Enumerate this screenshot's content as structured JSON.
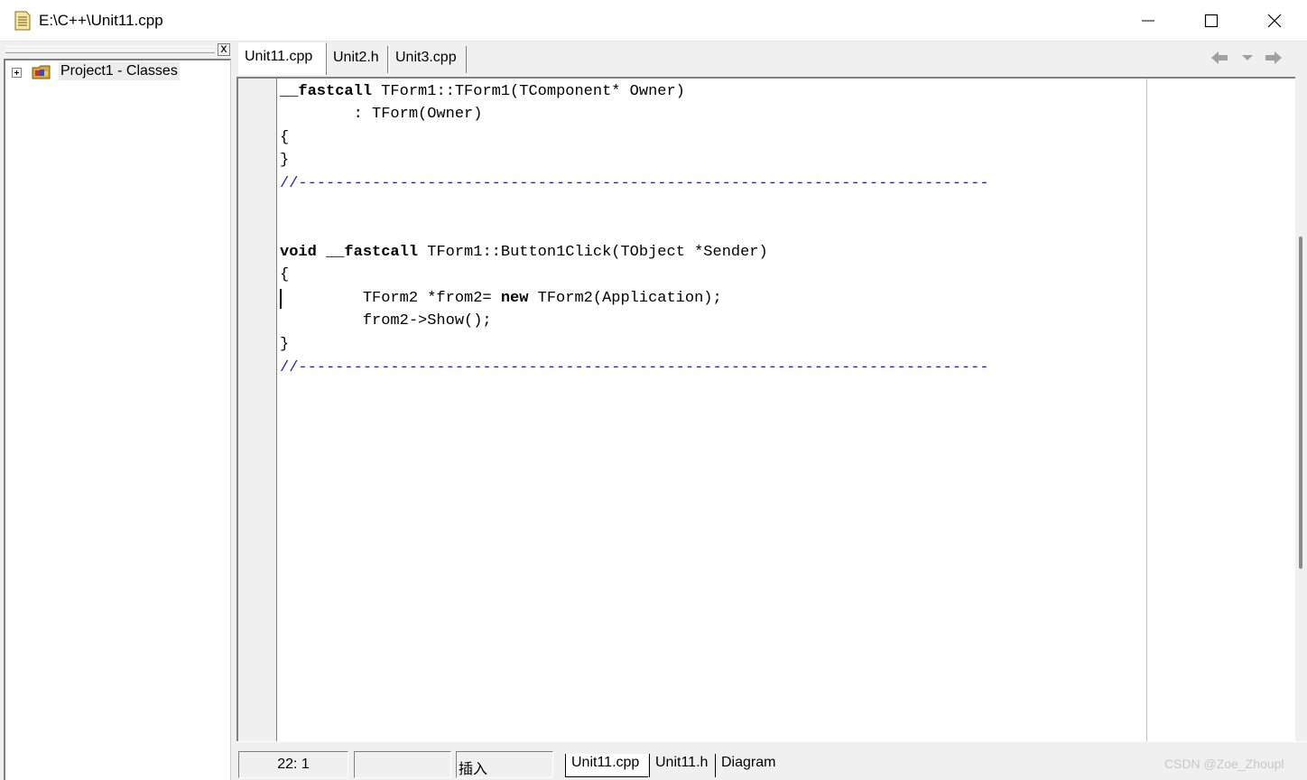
{
  "window": {
    "title": "E:\\C++\\Unit11.cpp"
  },
  "project_tree": {
    "root_label": "Project1 - Classes",
    "close_glyph": "x"
  },
  "editor_tabs": [
    {
      "label": "Unit11.cpp",
      "active": true
    },
    {
      "label": "Unit2.h",
      "active": false
    },
    {
      "label": "Unit3.cpp",
      "active": false
    }
  ],
  "code": {
    "line1_a": "__fastcall",
    "line1_b": " TForm1::TForm1(TComponent* Owner)",
    "line2": "        : TForm(Owner)",
    "line3": "{",
    "line4": "}",
    "line5": "//---------------------------------------------------------------------------",
    "line8_kw1": "void",
    "line8_sp": " ",
    "line8_kw2": "__fastcall",
    "line8_rest": " TForm1::Button1Click(TObject *Sender)",
    "line9": "{",
    "line10_a": "         TForm2 *from2= ",
    "line10_kw": "new",
    "line10_b": " TForm2(Application);",
    "line11": "         from2->Show();",
    "line12": "}",
    "line13": "//---------------------------------------------------------------------------"
  },
  "status": {
    "position": "22:  1",
    "modified": "",
    "mode": "插入"
  },
  "bottom_tabs": [
    {
      "label": "Unit11.cpp",
      "active": true
    },
    {
      "label": "Unit11.h",
      "active": false
    },
    {
      "label": "Diagram",
      "active": false
    }
  ],
  "watermark": "CSDN @Zoe_Zhoupl",
  "colors": {
    "comment": "#2020c0",
    "background": "#f0f0f0",
    "editor_bg": "#ffffff"
  }
}
